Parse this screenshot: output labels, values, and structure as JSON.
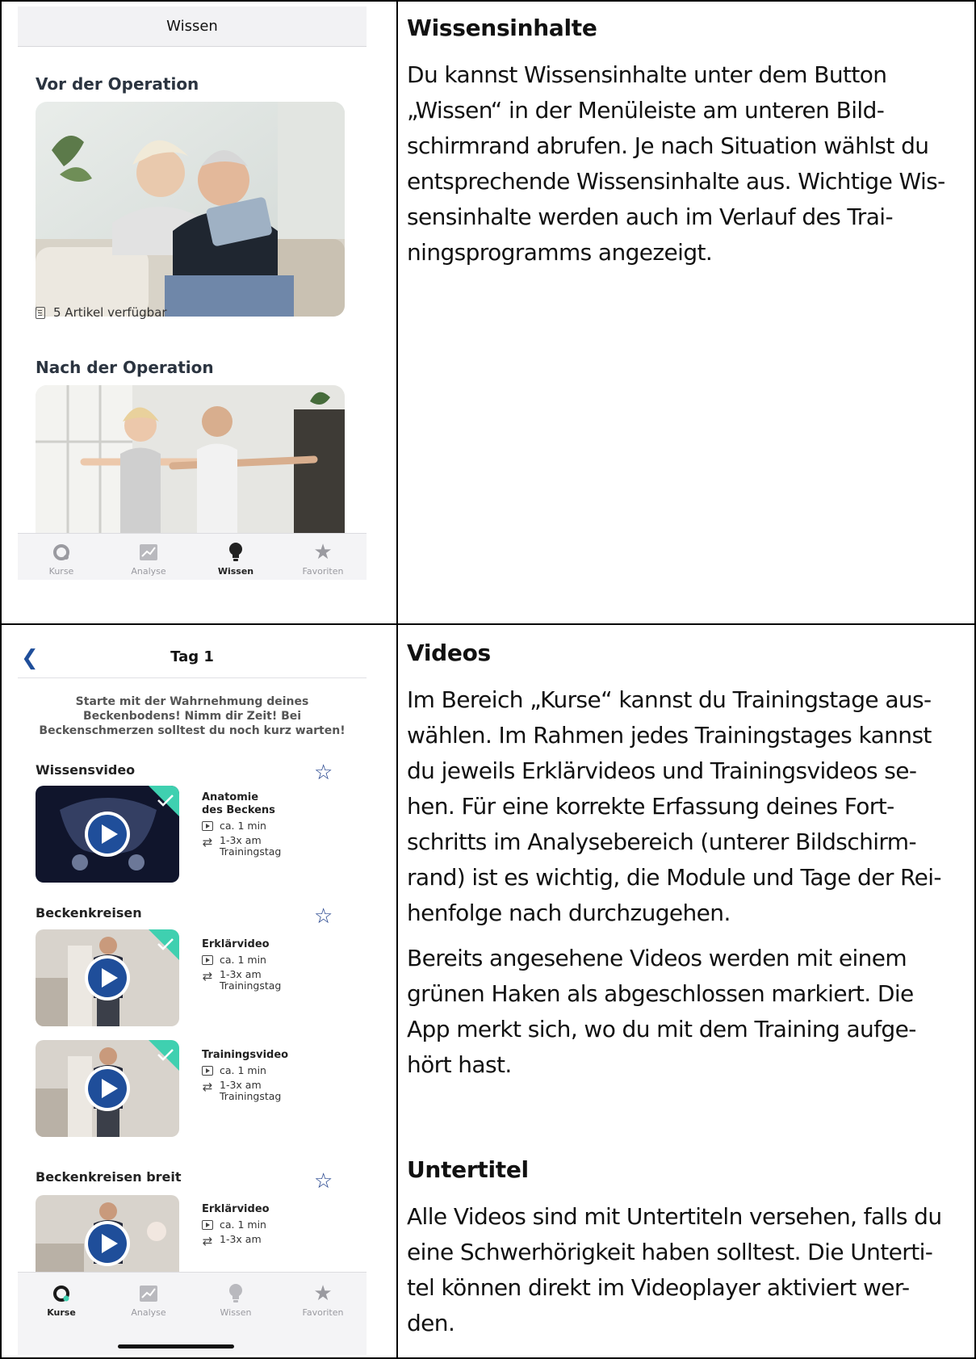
{
  "colors": {
    "accent_blue": "#1f4e9a",
    "check_green": "#3fd0b0",
    "tab_inactive": "#9a9aa0"
  },
  "screen1": {
    "header_title": "Wissen",
    "before_op": {
      "title": "Vor der Operation",
      "meta": "5 Artikel verfügbar"
    },
    "after_op": {
      "title": "Nach der Operation"
    },
    "tabbar": [
      {
        "label": "Kurse",
        "icon": "courses-ring-icon"
      },
      {
        "label": "Analyse",
        "icon": "chart-icon"
      },
      {
        "label": "Wissen",
        "icon": "lightbulb-icon",
        "active": true
      },
      {
        "label": "Favoriten",
        "icon": "star-icon"
      }
    ]
  },
  "screen2": {
    "header_title": "Tag 1",
    "back_icon": "chevron-left-icon",
    "intro": "Starte mit der Wahrnehmung deines Beckenbodens! Nimm dir Zeit! Bei Beckenschmerzen solltest du noch kurz warten!",
    "modules": [
      {
        "title": "Wissensvideo",
        "videos": [
          {
            "title": "Anatomie des Beckens",
            "duration": "ca. 1 min",
            "frequency": "1-3x am Trainingstag",
            "completed": true
          }
        ]
      },
      {
        "title": "Beckenkreisen",
        "videos": [
          {
            "title": "Erklärvideo",
            "duration": "ca. 1 min",
            "frequency": "1-3x am Trainingstag",
            "completed": true
          },
          {
            "title": "Trainingsvideo",
            "duration": "ca. 1 min",
            "frequency": "1-3x am Trainingstag",
            "completed": true
          }
        ]
      },
      {
        "title": "Beckenkreisen breit",
        "videos": [
          {
            "title": "Erklärvideo",
            "duration": "ca. 1 min",
            "frequency": "1-3x am",
            "completed": false
          }
        ]
      }
    ],
    "tabbar": [
      {
        "label": "Kurse",
        "icon": "courses-ring-icon",
        "active": true
      },
      {
        "label": "Analyse",
        "icon": "chart-icon"
      },
      {
        "label": "Wissen",
        "icon": "lightbulb-icon"
      },
      {
        "label": "Favoriten",
        "icon": "star-icon"
      }
    ]
  },
  "text": {
    "knowledge": {
      "heading": "Wissensinhalte",
      "lines": [
        "Du kannst Wissensinhalte unter dem Button",
        "„Wissen“ in der Menüleiste am unteren Bild-",
        "schirmrand abrufen. Je nach Situation wählst du",
        "entsprechende Wissensinhalte aus. Wichtige Wis-",
        "sensinhalte werden auch im Verlauf des Trai-",
        "ningsprogramms angezeigt."
      ]
    },
    "videos": {
      "heading": "Videos",
      "p1_lines": [
        "Im Bereich „Kurse“ kannst du Trainingstage aus-",
        "wählen. Im Rahmen jedes Trainingstages kannst",
        "du jeweils Erklärvideos und Trainingsvideos se-",
        "hen. Für eine korrekte Erfassung deines Fort-",
        "schritts im Analysebereich (unterer Bildschirm-",
        "rand) ist es wichtig, die Module und Tage der Rei-",
        "henfolge nach durchzugehen."
      ],
      "p2_lines": [
        "Bereits angesehene Videos werden mit einem",
        "grünen Haken als abgeschlossen markiert. Die",
        "App merkt sich, wo du mit dem Training aufge-",
        "hört hast."
      ]
    },
    "subtitles": {
      "heading": "Untertitel",
      "lines": [
        "Alle Videos sind mit Untertiteln versehen, falls du",
        "eine Schwerhörigkeit haben solltest. Die Unterti-",
        "tel können direkt im Videoplayer aktiviert wer-",
        "den."
      ]
    }
  }
}
